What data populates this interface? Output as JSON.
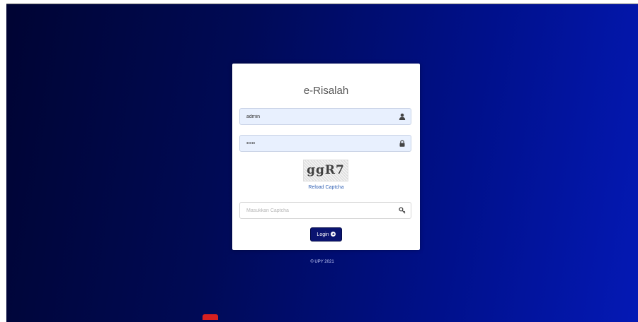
{
  "login_card": {
    "title": "e-Risalah",
    "username": {
      "value": "admin",
      "placeholder": "",
      "icon": "user-icon"
    },
    "password": {
      "value": "•••••",
      "placeholder": "",
      "icon": "lock-icon"
    },
    "captcha": {
      "image_text": "ggR7",
      "reload_label": "Reload Captcha",
      "input_placeholder": "Masukkan Captcha",
      "icon": "key-icon"
    },
    "login_button": {
      "label": "Login",
      "icon": "arrow-circle-right-icon"
    }
  },
  "footer": {
    "copyright": "© UPY 2021"
  },
  "colors": {
    "background_dark": "#000433",
    "background_light": "#0419b5",
    "input_fill": "#e8f0fe",
    "button": "#0a1470",
    "link": "#2f5fb3"
  }
}
